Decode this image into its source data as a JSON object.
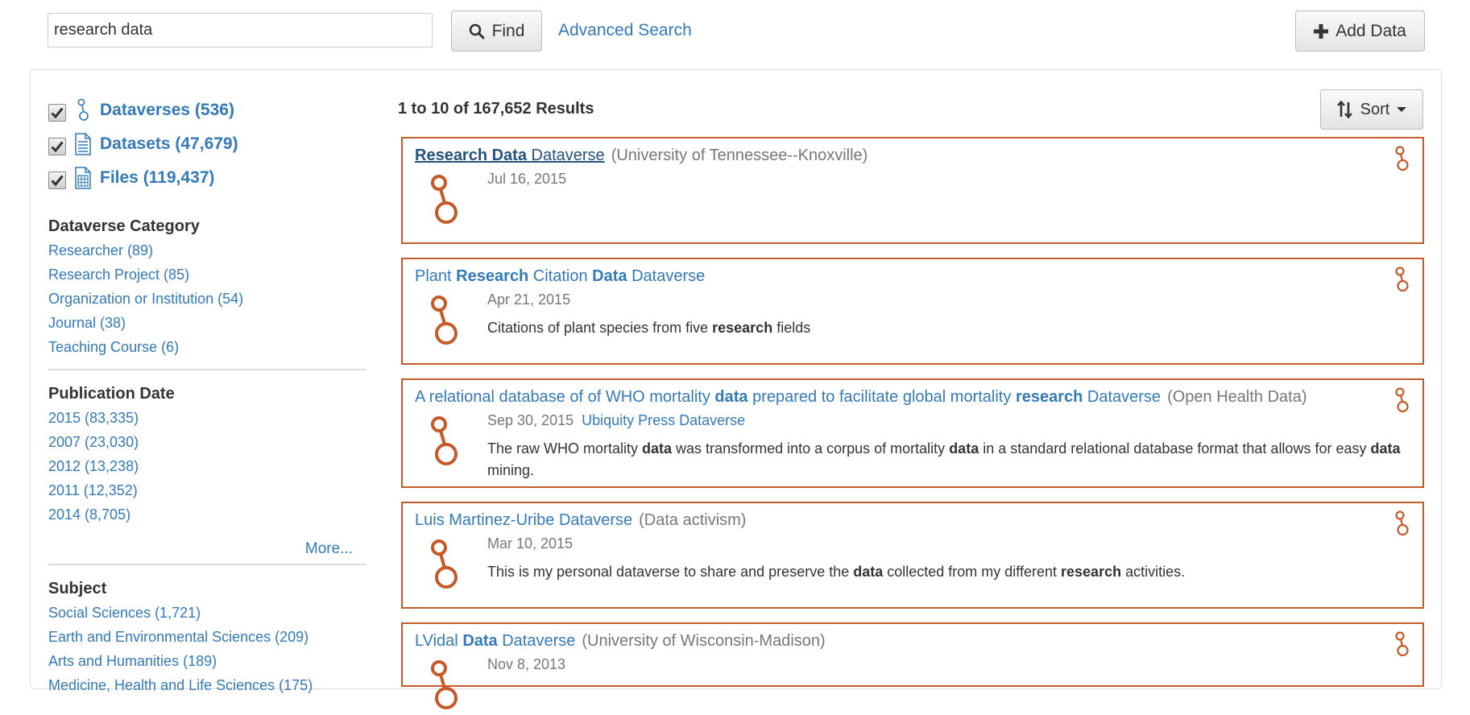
{
  "search": {
    "value": "research data",
    "find_label": "Find",
    "advanced_label": "Advanced Search",
    "add_label": "Add Data"
  },
  "types": [
    {
      "label": "Dataverses (536)",
      "icon": "dataverse-icon",
      "checked": true
    },
    {
      "label": "Datasets (47,679)",
      "icon": "dataset-icon",
      "checked": true
    },
    {
      "label": "Files (119,437)",
      "icon": "file-icon",
      "checked": true
    }
  ],
  "facets": {
    "category": {
      "title": "Dataverse Category",
      "items": [
        "Researcher (89)",
        "Research Project (85)",
        "Organization or Institution (54)",
        "Journal (38)",
        "Teaching Course (6)"
      ]
    },
    "pubdate": {
      "title": "Publication Date",
      "items": [
        "2015 (83,335)",
        "2007 (23,030)",
        "2012 (13,238)",
        "2011 (12,352)",
        "2014 (8,705)"
      ],
      "more_label": "More..."
    },
    "subject": {
      "title": "Subject",
      "items": [
        "Social Sciences (1,721)",
        "Earth and Environmental Sciences (209)",
        "Arts and Humanities (189)",
        "Medicine, Health and Life Sciences (175)"
      ]
    }
  },
  "results_count": "1 to 10 of 167,652 Results",
  "sort_label": "Sort",
  "colors": {
    "dataverse_accent": "#c55a28",
    "link": "#337ab7"
  },
  "results": [
    {
      "title": [
        {
          "t": "Research Data",
          "b": true
        },
        {
          "t": " Dataverse"
        }
      ],
      "affiliation": "(University of Tennessee--Knoxville)",
      "date": "Jul 16, 2015",
      "parent": "",
      "description": []
    },
    {
      "title": [
        {
          "t": "Plant "
        },
        {
          "t": "Research",
          "b": true
        },
        {
          "t": " Citation "
        },
        {
          "t": "Data",
          "b": true
        },
        {
          "t": " Dataverse"
        }
      ],
      "affiliation": "",
      "date": "Apr 21, 2015",
      "parent": "",
      "description": [
        {
          "t": "Citations of plant species from five "
        },
        {
          "t": "research",
          "b": true
        },
        {
          "t": " fields"
        }
      ]
    },
    {
      "title": [
        {
          "t": "A relational database of of WHO mortality "
        },
        {
          "t": "data",
          "b": true
        },
        {
          "t": " prepared to facilitate global mortality "
        },
        {
          "t": "research",
          "b": true
        },
        {
          "t": " Dataverse"
        }
      ],
      "affiliation": "(Open Health Data)",
      "date": "Sep 30, 2015",
      "parent": "Ubiquity Press Dataverse",
      "description": [
        {
          "t": "The raw WHO mortality "
        },
        {
          "t": "data",
          "b": true
        },
        {
          "t": " was transformed into a corpus of mortality "
        },
        {
          "t": "data",
          "b": true
        },
        {
          "t": " in a standard relational database format that allows for easy "
        },
        {
          "t": "data",
          "b": true
        },
        {
          "t": " mining."
        }
      ]
    },
    {
      "title": [
        {
          "t": "Luis Martinez-Uribe Dataverse"
        }
      ],
      "affiliation": "(Data activism)",
      "date": "Mar 10, 2015",
      "parent": "",
      "description": [
        {
          "t": "This is my personal dataverse to share and preserve the "
        },
        {
          "t": "data",
          "b": true
        },
        {
          "t": " collected from my different "
        },
        {
          "t": "research",
          "b": true
        },
        {
          "t": " activities."
        }
      ]
    },
    {
      "title": [
        {
          "t": "LVidal "
        },
        {
          "t": "Data",
          "b": true
        },
        {
          "t": " Dataverse"
        }
      ],
      "affiliation": "(University of Wisconsin-Madison)",
      "date": "Nov 8, 2013",
      "parent": "",
      "description": []
    }
  ]
}
